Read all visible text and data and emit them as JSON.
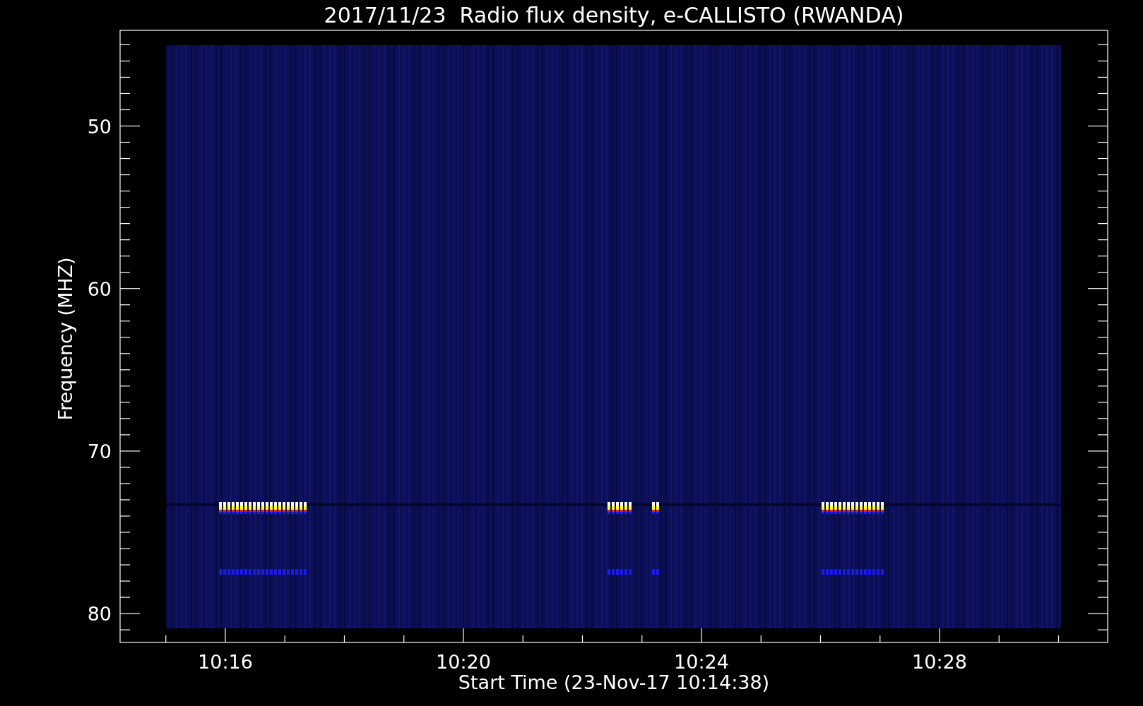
{
  "title": "2017/11/23  Radio flux density, e-CALLISTO (RWANDA)",
  "y_axis": {
    "label": "Frequency (MHZ)",
    "ticks": [
      "50",
      "60",
      "70",
      "80"
    ]
  },
  "x_axis": {
    "label": "Start Time (23-Nov-17 10:14:38)",
    "ticks": [
      "10:16",
      "10:20",
      "10:24",
      "10:28"
    ]
  }
}
